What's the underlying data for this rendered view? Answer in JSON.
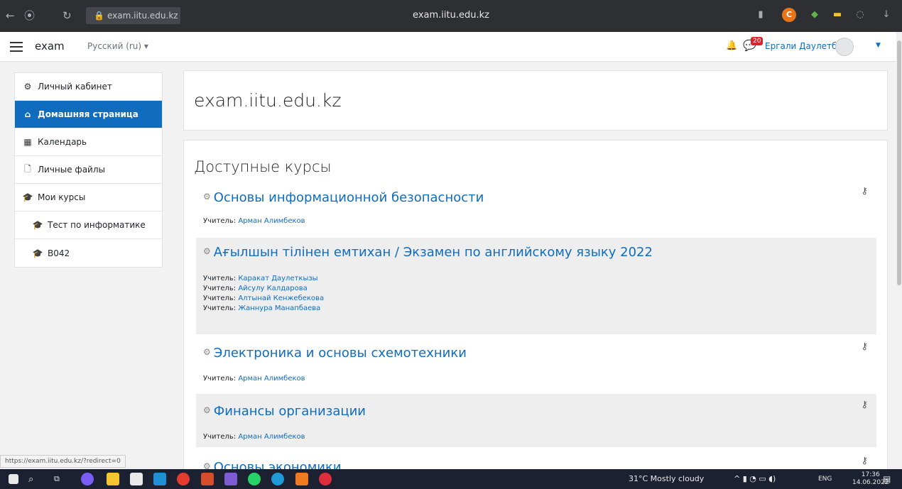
{
  "browser": {
    "url_short": "exam.iitu.edu.kz",
    "tab_title": "exam.iitu.edu.kz",
    "icons": [
      "back-icon",
      "yandex-icon",
      "reload-icon",
      "lock-icon",
      "bookmark-icon",
      "extension-icon",
      "download-icon"
    ]
  },
  "navbar": {
    "brand": "exam",
    "language": "Русский (ru) ▾",
    "notification_count": "20",
    "user_name": "Ергали Даулетбек"
  },
  "sidebar": {
    "items": [
      {
        "label": "Личный кабинет",
        "icon": "dashboard-icon",
        "glyph": "⚙"
      },
      {
        "label": "Домашняя страница",
        "icon": "home-icon",
        "glyph": "⌂",
        "active": true
      },
      {
        "label": "Календарь",
        "icon": "calendar-icon",
        "glyph": "▦"
      },
      {
        "label": "Личные файлы",
        "icon": "file-icon",
        "glyph": "🗋"
      },
      {
        "label": "Мои курсы",
        "icon": "graduation-cap-icon",
        "glyph": "🎓"
      },
      {
        "label": "Тест по информатике",
        "icon": "graduation-cap-icon",
        "glyph": "🎓"
      },
      {
        "label": "B042",
        "icon": "graduation-cap-icon",
        "glyph": "🎓"
      }
    ]
  },
  "main": {
    "site_title": "exam.iitu.edu.kz",
    "courses_heading": "Доступные курсы",
    "teacher_prefix": "Учитель:",
    "courses": [
      {
        "title": "Основы информационной безопасности",
        "teachers": [
          "Арман Алимбеков"
        ],
        "has_key": true
      },
      {
        "title": "Ағылшын тілінен емтихан / Экзамен по английскому языку 2022",
        "teachers": [
          "Каракат Даулеткызы",
          "Айсулу Калдарова",
          "Алтынай Кенжебекова",
          "Жаннура Манапбаева"
        ],
        "has_key": false
      },
      {
        "title": "Электроника и основы схемотехники",
        "teachers": [
          "Арман Алимбеков"
        ],
        "has_key": true
      },
      {
        "title": "Финансы организации",
        "teachers": [
          "Арман Алимбеков"
        ],
        "has_key": true
      },
      {
        "title": "Основы экономики",
        "teachers": [],
        "has_key": true
      }
    ]
  },
  "status_url": "https://exam.iitu.edu.kz/?redirect=0",
  "taskbar": {
    "weather": "31°C  Mostly cloudy",
    "lang": "ENG",
    "time": "17:36",
    "date": "14.06.2022",
    "notification_count": "4"
  },
  "colors": {
    "accent": "#0f6cbf",
    "browser_bar": "#2d2f33",
    "taskbar": "#1b2130",
    "badge": "#d9232d"
  }
}
